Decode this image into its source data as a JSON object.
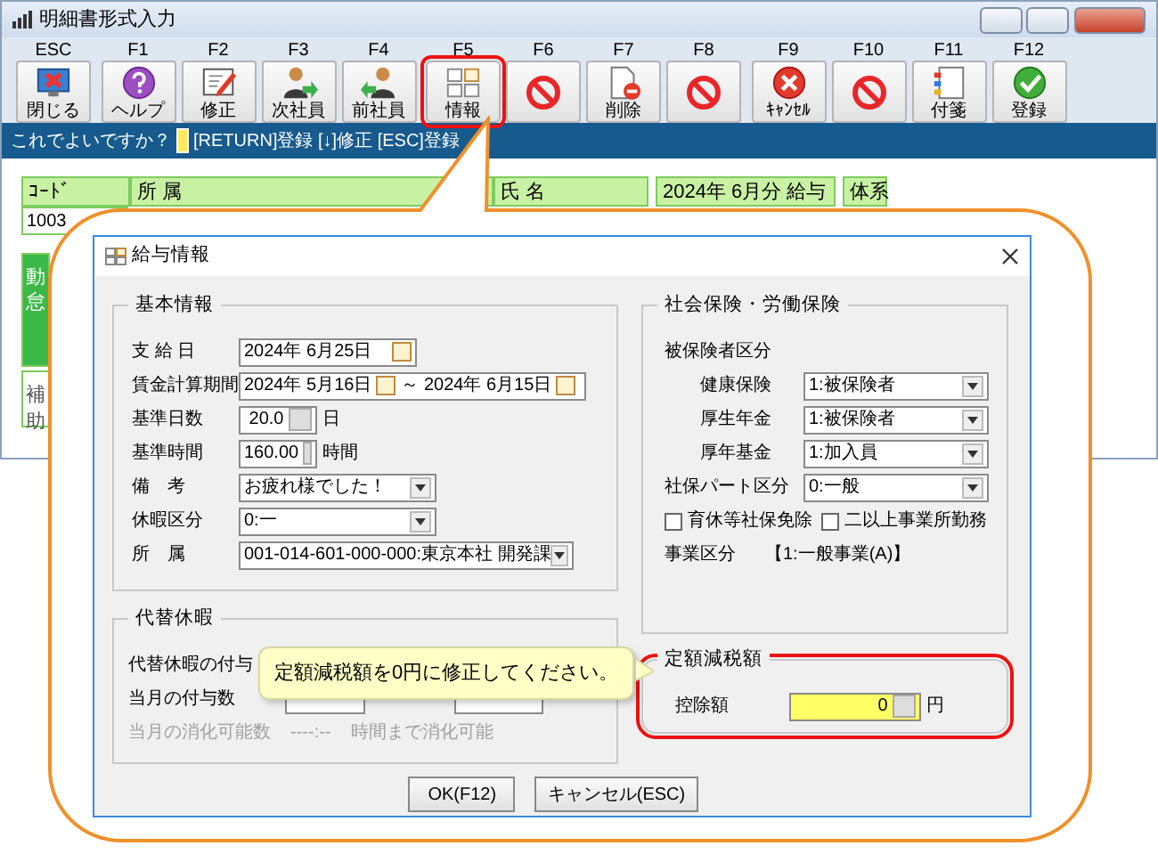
{
  "window": {
    "title": "明細書形式入力"
  },
  "toolbar": [
    [
      {
        "key": "ESC",
        "caption": "閉じる",
        "kind": "close",
        "highlighted": false
      }
    ],
    [
      {
        "key": "F1",
        "caption": "ヘルプ",
        "kind": "help",
        "highlighted": false
      },
      {
        "key": "F2",
        "caption": "修正",
        "kind": "edit",
        "highlighted": false
      },
      {
        "key": "F3",
        "caption": "次社員",
        "kind": "next",
        "highlighted": false
      },
      {
        "key": "F4",
        "caption": "前社員",
        "kind": "prev",
        "highlighted": false
      }
    ],
    [
      {
        "key": "F5",
        "caption": "情報",
        "kind": "info",
        "highlighted": true
      },
      {
        "key": "F6",
        "kind": "unavailable",
        "highlighted": false
      },
      {
        "key": "F7",
        "caption": "削除",
        "kind": "delete",
        "highlighted": false
      },
      {
        "key": "F8",
        "kind": "unavailable",
        "highlighted": false
      }
    ],
    [
      {
        "key": "F9",
        "caption": "ｷｬﾝｾﾙ",
        "kind": "cancel",
        "highlighted": false
      },
      {
        "key": "F10",
        "kind": "unavailable",
        "highlighted": false
      },
      {
        "key": "F11",
        "caption": "付箋",
        "kind": "note",
        "highlighted": false
      },
      {
        "key": "F12",
        "caption": "登録",
        "kind": "ok",
        "highlighted": false
      }
    ]
  ],
  "prompt": {
    "question": "これでよいですか？",
    "keys": "[RETURN]登録 [↓]修正 [ESC]登録"
  },
  "table": {
    "columns": [
      "ｺｰﾄﾞ",
      "所 属",
      "氏 名",
      "2024年 6月分 給与",
      "体系"
    ],
    "code": "1003"
  },
  "side_cells": [
    {
      "text": "動怠",
      "kind": "green"
    },
    {
      "text": "補助",
      "kind": "plain"
    }
  ],
  "dialog": {
    "title": "給与情報",
    "basic": {
      "title": "基本情報",
      "rows": [
        {
          "label": "支 給 日",
          "kind": "date",
          "value": "2024年 6月25日"
        },
        {
          "label": "賃金計算期間",
          "kind": "period",
          "from": "2024年 5月16日",
          "separator": "～",
          "to": "2024年 6月15日"
        },
        {
          "label": "基準日数",
          "kind": "number",
          "value": "20.0",
          "unit": "日"
        },
        {
          "label": "基準時間",
          "kind": "number",
          "value": "160.00",
          "unit": "時間"
        },
        {
          "label": "備　考",
          "kind": "select",
          "value": "お疲れ様でした！"
        },
        {
          "label": "休暇区分",
          "kind": "select",
          "value": "0:一"
        },
        {
          "label": "所　属",
          "kind": "wide-select",
          "value": "001-014-601-000-000:東京本社 開発課"
        }
      ]
    },
    "insurance": {
      "title": "社会保険・労働保険",
      "subtitle": "被保険者区分",
      "rows": [
        {
          "label": "健康保険",
          "kind": "sub",
          "value": "1:被保険者"
        },
        {
          "label": "厚生年金",
          "kind": "sub",
          "value": "1:被保険者"
        },
        {
          "label": "厚年基金",
          "kind": "sub",
          "value": "1:加入員"
        },
        {
          "label": "社保パート区分",
          "kind": "main",
          "value": "0:一般"
        }
      ],
      "checkboxes": [
        {
          "label": "育休等社保免除",
          "checked": false
        },
        {
          "label": "二以上事業所勤務",
          "checked": false
        }
      ],
      "business": {
        "label": "事業区分",
        "value": "【1:一般事業(A)】"
      }
    },
    "substitute": {
      "title": "代替休暇",
      "rows": [
        {
          "label": "代替休暇の付与"
        },
        {
          "label": "当月の付与数"
        }
      ],
      "available": {
        "label": "当月の消化可能数",
        "value": "----:--",
        "suffix": "時間まで消化可能",
        "disabled": true
      }
    },
    "tax": {
      "title": "定額減税額",
      "label": "控除額",
      "value": "0",
      "unit": "円",
      "highlighted": true
    },
    "buttons": [
      "OK(F12)",
      "キャンセル(ESC)"
    ]
  },
  "tooltip": "定額減税額を0円に修正してください。"
}
